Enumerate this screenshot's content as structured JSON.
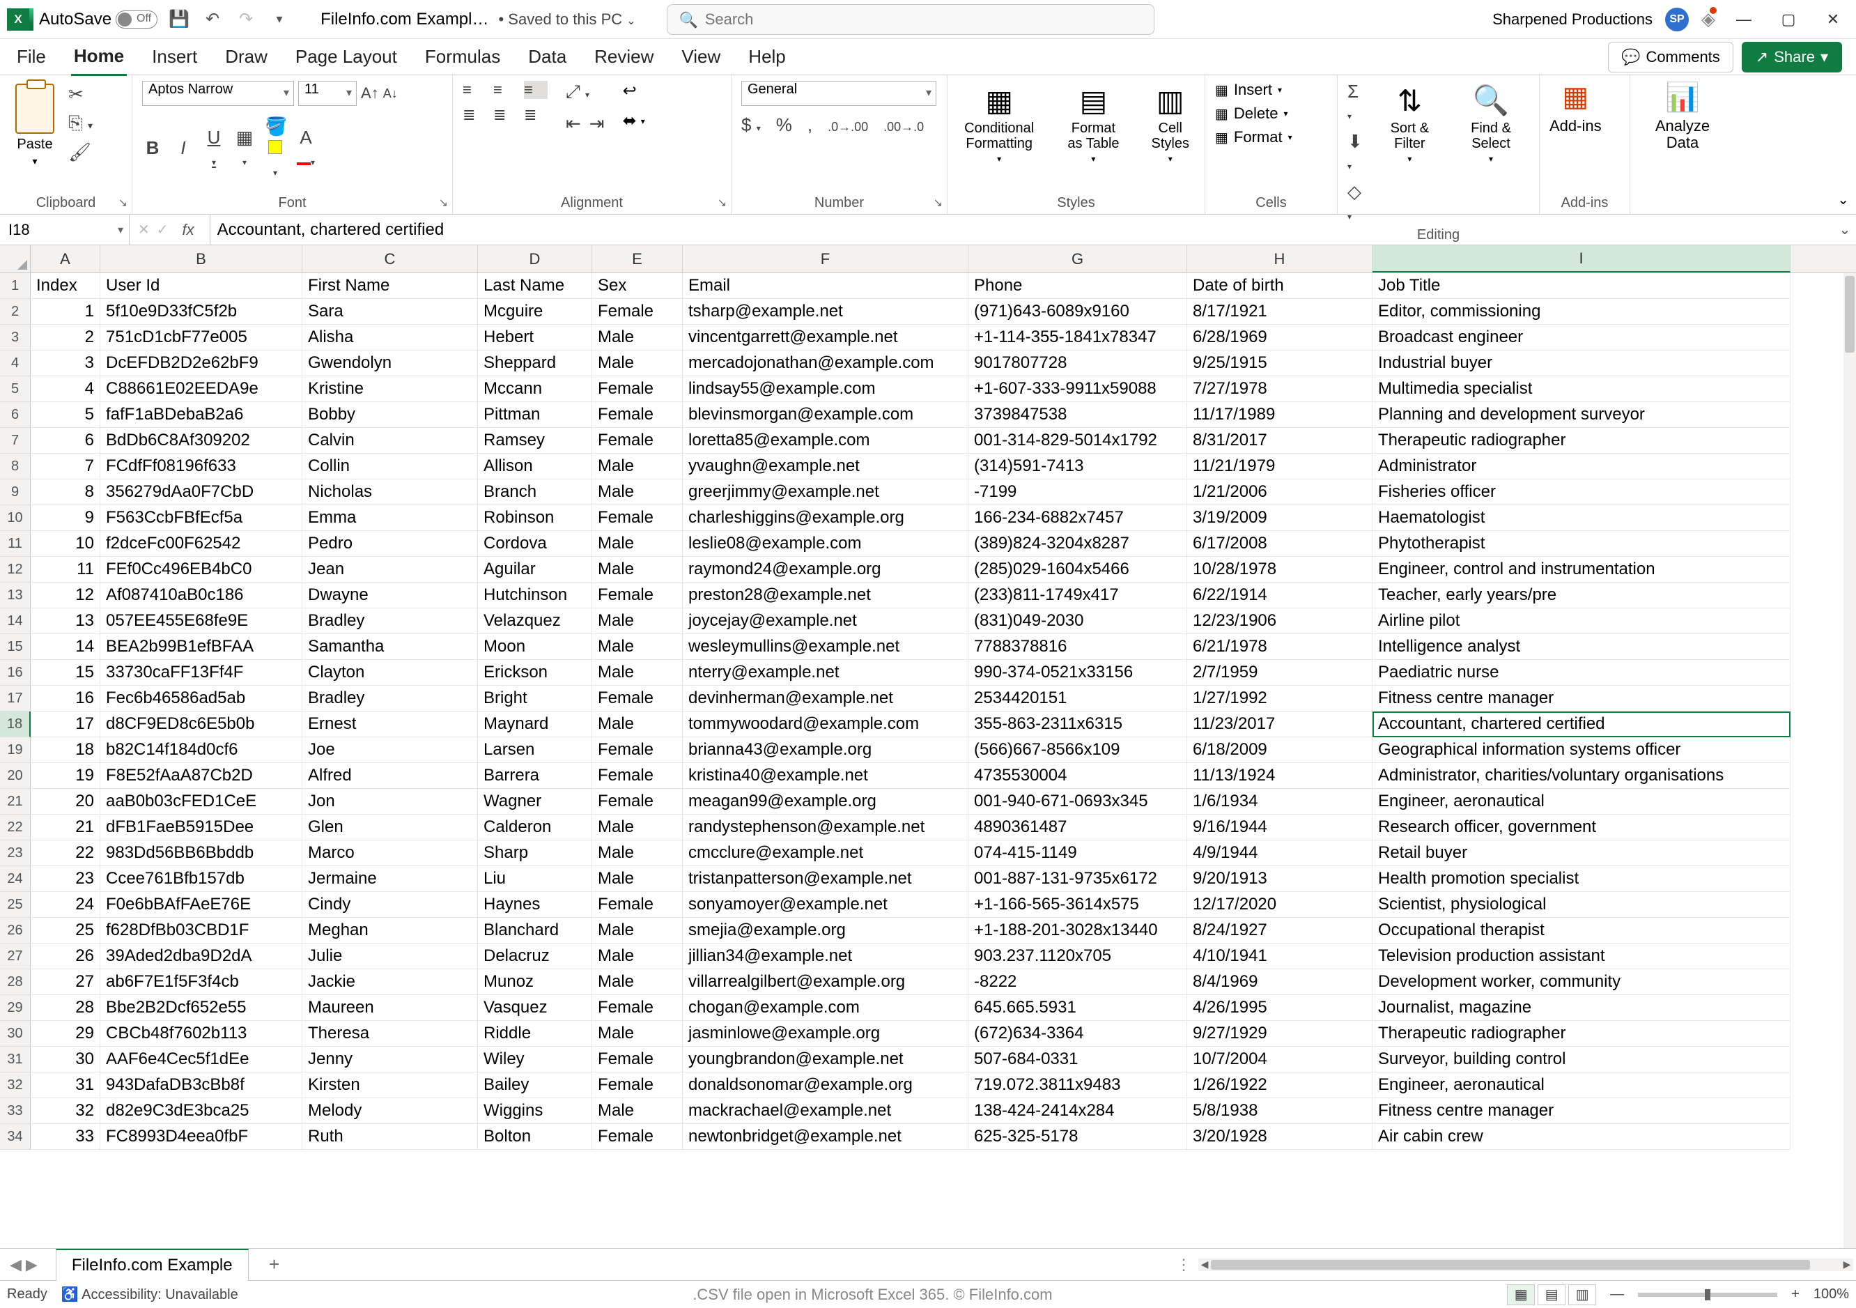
{
  "titlebar": {
    "autosave_label": "AutoSave",
    "autosave_toggle": "Off",
    "doc_title": "FileInfo.com Exampl…",
    "saved_status": "• Saved to this PC",
    "search_placeholder": "Search",
    "user_name": "Sharpened Productions",
    "user_initials": "SP"
  },
  "ribbon": {
    "tabs": [
      "File",
      "Home",
      "Insert",
      "Draw",
      "Page Layout",
      "Formulas",
      "Data",
      "Review",
      "View",
      "Help"
    ],
    "comments_label": "Comments",
    "share_label": "Share",
    "clipboard": {
      "paste": "Paste",
      "group": "Clipboard"
    },
    "font": {
      "name": "Aptos Narrow",
      "size": "11",
      "group": "Font"
    },
    "alignment": {
      "group": "Alignment"
    },
    "number": {
      "format": "General",
      "group": "Number"
    },
    "styles": {
      "conditional": "Conditional Formatting",
      "format_as_table": "Format as Table",
      "cell_styles": "Cell Styles",
      "group": "Styles"
    },
    "cells": {
      "insert": "Insert",
      "delete": "Delete",
      "format": "Format",
      "group": "Cells"
    },
    "editing": {
      "sort": "Sort & Filter",
      "find": "Find & Select",
      "group": "Editing"
    },
    "addins": {
      "label": "Add-ins",
      "group": "Add-ins"
    },
    "analyze": {
      "label": "Analyze Data"
    }
  },
  "formula_bar": {
    "name_box": "I18",
    "formula": "Accountant, chartered certified"
  },
  "grid": {
    "columns": [
      "A",
      "B",
      "C",
      "D",
      "E",
      "F",
      "G",
      "H",
      "I"
    ],
    "header_row": [
      "Index",
      "User Id",
      "First Name",
      "Last Name",
      "Sex",
      "Email",
      "Phone",
      "Date of birth",
      "Job Title"
    ],
    "rows": [
      [
        "1",
        "5f10e9D33fC5f2b",
        "Sara",
        "Mcguire",
        "Female",
        "tsharp@example.net",
        "(971)643-6089x9160",
        "8/17/1921",
        "Editor, commissioning"
      ],
      [
        "2",
        "751cD1cbF77e005",
        "Alisha",
        "Hebert",
        "Male",
        "vincentgarrett@example.net",
        "+1-114-355-1841x78347",
        "6/28/1969",
        "Broadcast engineer"
      ],
      [
        "3",
        "DcEFDB2D2e62bF9",
        "Gwendolyn",
        "Sheppard",
        "Male",
        "mercadojonathan@example.com",
        "9017807728",
        "9/25/1915",
        "Industrial buyer"
      ],
      [
        "4",
        "C88661E02EEDA9e",
        "Kristine",
        "Mccann",
        "Female",
        "lindsay55@example.com",
        "+1-607-333-9911x59088",
        "7/27/1978",
        "Multimedia specialist"
      ],
      [
        "5",
        "fafF1aBDebaB2a6",
        "Bobby",
        "Pittman",
        "Female",
        "blevinsmorgan@example.com",
        "3739847538",
        "11/17/1989",
        "Planning and development surveyor"
      ],
      [
        "6",
        "BdDb6C8Af309202",
        "Calvin",
        "Ramsey",
        "Female",
        "loretta85@example.com",
        "001-314-829-5014x1792",
        "8/31/2017",
        "Therapeutic radiographer"
      ],
      [
        "7",
        "FCdfFf08196f633",
        "Collin",
        "Allison",
        "Male",
        "yvaughn@example.net",
        "(314)591-7413",
        "11/21/1979",
        "Administrator"
      ],
      [
        "8",
        "356279dAa0F7CbD",
        "Nicholas",
        "Branch",
        "Male",
        "greerjimmy@example.net",
        "-7199",
        "1/21/2006",
        "Fisheries officer"
      ],
      [
        "9",
        "F563CcbFBfEcf5a",
        "Emma",
        "Robinson",
        "Female",
        "charleshiggins@example.org",
        "166-234-6882x7457",
        "3/19/2009",
        "Haematologist"
      ],
      [
        "10",
        "f2dceFc00F62542",
        "Pedro",
        "Cordova",
        "Male",
        "leslie08@example.com",
        "(389)824-3204x8287",
        "6/17/2008",
        "Phytotherapist"
      ],
      [
        "11",
        "FEf0Cc496EB4bC0",
        "Jean",
        "Aguilar",
        "Male",
        "raymond24@example.org",
        "(285)029-1604x5466",
        "10/28/1978",
        "Engineer, control and instrumentation"
      ],
      [
        "12",
        "Af087410aB0c186",
        "Dwayne",
        "Hutchinson",
        "Female",
        "preston28@example.net",
        "(233)811-1749x417",
        "6/22/1914",
        "Teacher, early years/pre"
      ],
      [
        "13",
        "057EE455E68fe9E",
        "Bradley",
        "Velazquez",
        "Male",
        "joycejay@example.net",
        "(831)049-2030",
        "12/23/1906",
        "Airline pilot"
      ],
      [
        "14",
        "BEA2b99B1efBFAA",
        "Samantha",
        "Moon",
        "Male",
        "wesleymullins@example.net",
        "7788378816",
        "6/21/1978",
        "Intelligence analyst"
      ],
      [
        "15",
        "33730caFF13Ff4F",
        "Clayton",
        "Erickson",
        "Male",
        "nterry@example.net",
        "990-374-0521x33156",
        "2/7/1959",
        "Paediatric nurse"
      ],
      [
        "16",
        "Fec6b46586ad5ab",
        "Bradley",
        "Bright",
        "Female",
        "devinherman@example.net",
        "2534420151",
        "1/27/1992",
        "Fitness centre manager"
      ],
      [
        "17",
        "d8CF9ED8c6E5b0b",
        "Ernest",
        "Maynard",
        "Male",
        "tommywoodard@example.com",
        "355-863-2311x6315",
        "11/23/2017",
        "Accountant, chartered certified"
      ],
      [
        "18",
        "b82C14f184d0cf6",
        "Joe",
        "Larsen",
        "Female",
        "brianna43@example.org",
        "(566)667-8566x109",
        "6/18/2009",
        "Geographical information systems officer"
      ],
      [
        "19",
        "F8E52fAaA87Cb2D",
        "Alfred",
        "Barrera",
        "Female",
        "kristina40@example.net",
        "4735530004",
        "11/13/1924",
        "Administrator, charities/voluntary organisations"
      ],
      [
        "20",
        "aaB0b03cFED1CeE",
        "Jon",
        "Wagner",
        "Female",
        "meagan99@example.org",
        "001-940-671-0693x345",
        "1/6/1934",
        "Engineer, aeronautical"
      ],
      [
        "21",
        "dFB1FaeB5915Dee",
        "Glen",
        "Calderon",
        "Male",
        "randystephenson@example.net",
        "4890361487",
        "9/16/1944",
        "Research officer, government"
      ],
      [
        "22",
        "983Dd56BB6Bbddb",
        "Marco",
        "Sharp",
        "Male",
        "cmcclure@example.net",
        "074-415-1149",
        "4/9/1944",
        "Retail buyer"
      ],
      [
        "23",
        "Ccee761Bfb157db",
        "Jermaine",
        "Liu",
        "Male",
        "tristanpatterson@example.net",
        "001-887-131-9735x6172",
        "9/20/1913",
        "Health promotion specialist"
      ],
      [
        "24",
        "F0e6bBAfFAeE76E",
        "Cindy",
        "Haynes",
        "Female",
        "sonyamoyer@example.net",
        "+1-166-565-3614x575",
        "12/17/2020",
        "Scientist, physiological"
      ],
      [
        "25",
        "f628DfBb03CBD1F",
        "Meghan",
        "Blanchard",
        "Male",
        "smejia@example.org",
        "+1-188-201-3028x13440",
        "8/24/1927",
        "Occupational therapist"
      ],
      [
        "26",
        "39Aded2dba9D2dA",
        "Julie",
        "Delacruz",
        "Male",
        "jillian34@example.net",
        "903.237.1120x705",
        "4/10/1941",
        "Television production assistant"
      ],
      [
        "27",
        "ab6F7E1f5F3f4cb",
        "Jackie",
        "Munoz",
        "Male",
        "villarrealgilbert@example.org",
        "-8222",
        "8/4/1969",
        "Development worker, community"
      ],
      [
        "28",
        "Bbe2B2Dcf652e55",
        "Maureen",
        "Vasquez",
        "Female",
        "chogan@example.com",
        "645.665.5931",
        "4/26/1995",
        "Journalist, magazine"
      ],
      [
        "29",
        "CBCb48f7602b113",
        "Theresa",
        "Riddle",
        "Male",
        "jasminlowe@example.org",
        "(672)634-3364",
        "9/27/1929",
        "Therapeutic radiographer"
      ],
      [
        "30",
        "AAF6e4Cec5f1dEe",
        "Jenny",
        "Wiley",
        "Female",
        "youngbrandon@example.net",
        "507-684-0331",
        "10/7/2004",
        "Surveyor, building control"
      ],
      [
        "31",
        "943DafaDB3cBb8f",
        "Kirsten",
        "Bailey",
        "Female",
        "donaldsonomar@example.org",
        "719.072.3811x9483",
        "1/26/1922",
        "Engineer, aeronautical"
      ],
      [
        "32",
        "d82e9C3dE3bca25",
        "Melody",
        "Wiggins",
        "Male",
        "mackrachael@example.net",
        "138-424-2414x284",
        "5/8/1938",
        "Fitness centre manager"
      ],
      [
        "33",
        "FC8993D4eea0fbF",
        "Ruth",
        "Bolton",
        "Female",
        "newtonbridget@example.net",
        "625-325-5178",
        "3/20/1928",
        "Air cabin crew"
      ]
    ],
    "selected_cell": {
      "row": 17,
      "col": 8
    },
    "selected_col_index": 8
  },
  "sheet_bar": {
    "tab_name": "FileInfo.com Example"
  },
  "status_bar": {
    "ready": "Ready",
    "accessibility": "Accessibility: Unavailable",
    "center": ".CSV file open in Microsoft Excel 365. © FileInfo.com",
    "zoom": "100%"
  }
}
